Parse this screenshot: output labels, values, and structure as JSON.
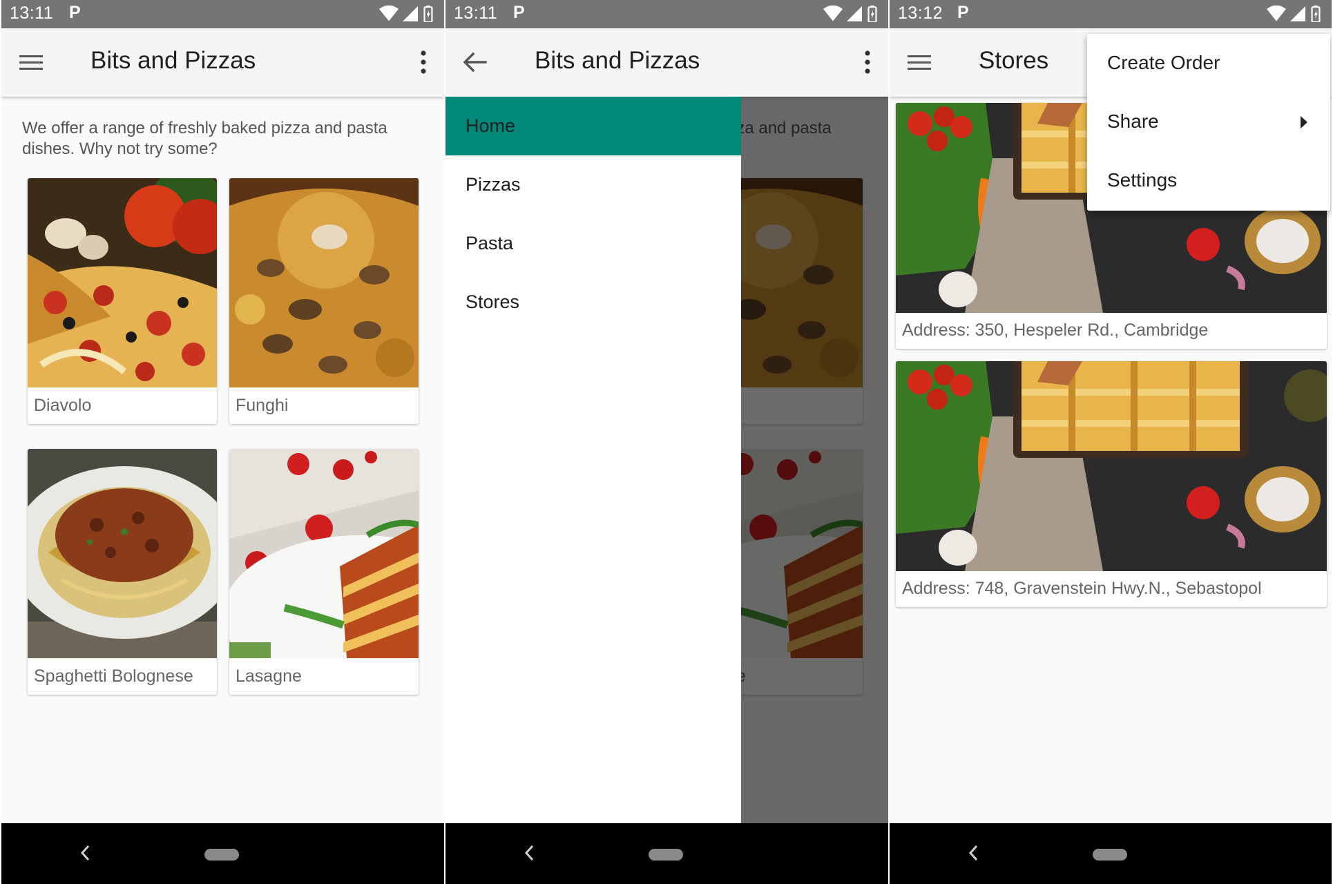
{
  "screens": [
    {
      "status": {
        "time": "13:11",
        "app_icon": "P"
      },
      "appbar": {
        "title": "Bits and Pizzas",
        "nav_icon": "menu-icon"
      },
      "intro": "We offer a range of freshly baked pizza and pasta dishes. Why not try some?",
      "dishes": [
        {
          "name": "Diavolo"
        },
        {
          "name": "Funghi"
        },
        {
          "name": "Spaghetti Bolognese"
        },
        {
          "name": "Lasagne"
        }
      ]
    },
    {
      "status": {
        "time": "13:11",
        "app_icon": "P"
      },
      "appbar": {
        "title": "Bits and Pizzas",
        "nav_icon": "arrow-back-icon"
      },
      "drawer": {
        "items": [
          {
            "label": "Home",
            "selected": true
          },
          {
            "label": "Pizzas",
            "selected": false
          },
          {
            "label": "Pasta",
            "selected": false
          },
          {
            "label": "Stores",
            "selected": false
          }
        ]
      }
    },
    {
      "status": {
        "time": "13:12",
        "app_icon": "P"
      },
      "appbar": {
        "title": "Stores",
        "nav_icon": "menu-icon"
      },
      "stores": [
        {
          "address": "Address: 350, Hespeler Rd., Cambridge"
        },
        {
          "address": "Address: 748, Gravenstein Hwy.N., Sebastopol"
        }
      ],
      "overflow_menu": {
        "items": [
          {
            "label": "Create Order",
            "has_submenu": false
          },
          {
            "label": "Share",
            "has_submenu": true
          },
          {
            "label": "Settings",
            "has_submenu": false
          }
        ]
      }
    }
  ],
  "colors": {
    "status_bar": "#757575",
    "app_bar": "#f5f5f5",
    "accent_selected": "#00897b",
    "nav_bar": "#000000"
  }
}
